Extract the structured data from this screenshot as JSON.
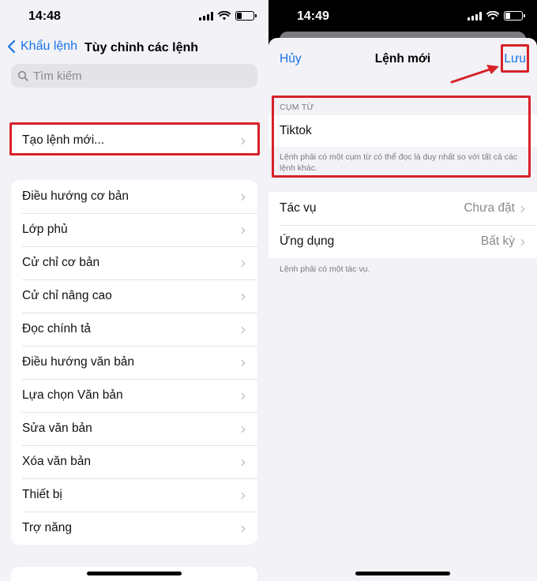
{
  "left": {
    "status": {
      "time": "14:48"
    },
    "nav": {
      "back_label": "Khẩu lệnh",
      "title": "Tùy chỉnh các lệnh"
    },
    "search": {
      "placeholder": "Tìm kiếm"
    },
    "create": {
      "label": "Tạo lệnh mới..."
    },
    "categories": [
      "Điều hướng cơ bản",
      "Lớp phủ",
      "Cử chỉ cơ bản",
      "Cử chỉ nâng cao",
      "Đọc chính tả",
      "Điều hướng văn bản",
      "Lựa chọn Văn bản",
      "Sửa văn bản",
      "Xóa văn bản",
      "Thiết bị",
      "Trợ năng"
    ]
  },
  "right": {
    "status": {
      "time": "14:49"
    },
    "sheet": {
      "cancel_label": "Hủy",
      "title": "Lệnh mới",
      "save_label": "Lưu"
    },
    "phrase": {
      "header": "CỤM TỪ",
      "value": "Tiktok",
      "footer": "Lệnh phải có một cụm từ có thể đọc là duy nhất so với tất cả các lệnh khác."
    },
    "settings": [
      {
        "label": "Tác vụ",
        "value": "Chưa đặt"
      },
      {
        "label": "Ứng dụng",
        "value": "Bất kỳ"
      }
    ],
    "footer": "Lệnh phải có một tác vụ."
  },
  "icons": {
    "back": "chevron-left-icon",
    "search": "search-icon",
    "disclosure": "chevron-right-icon",
    "signal": "cellular-signal-icon",
    "wifi": "wifi-icon",
    "battery": "battery-icon"
  },
  "colors": {
    "accent": "#1a73e8",
    "highlight": "#d62228",
    "background": "#f2f2f7"
  }
}
